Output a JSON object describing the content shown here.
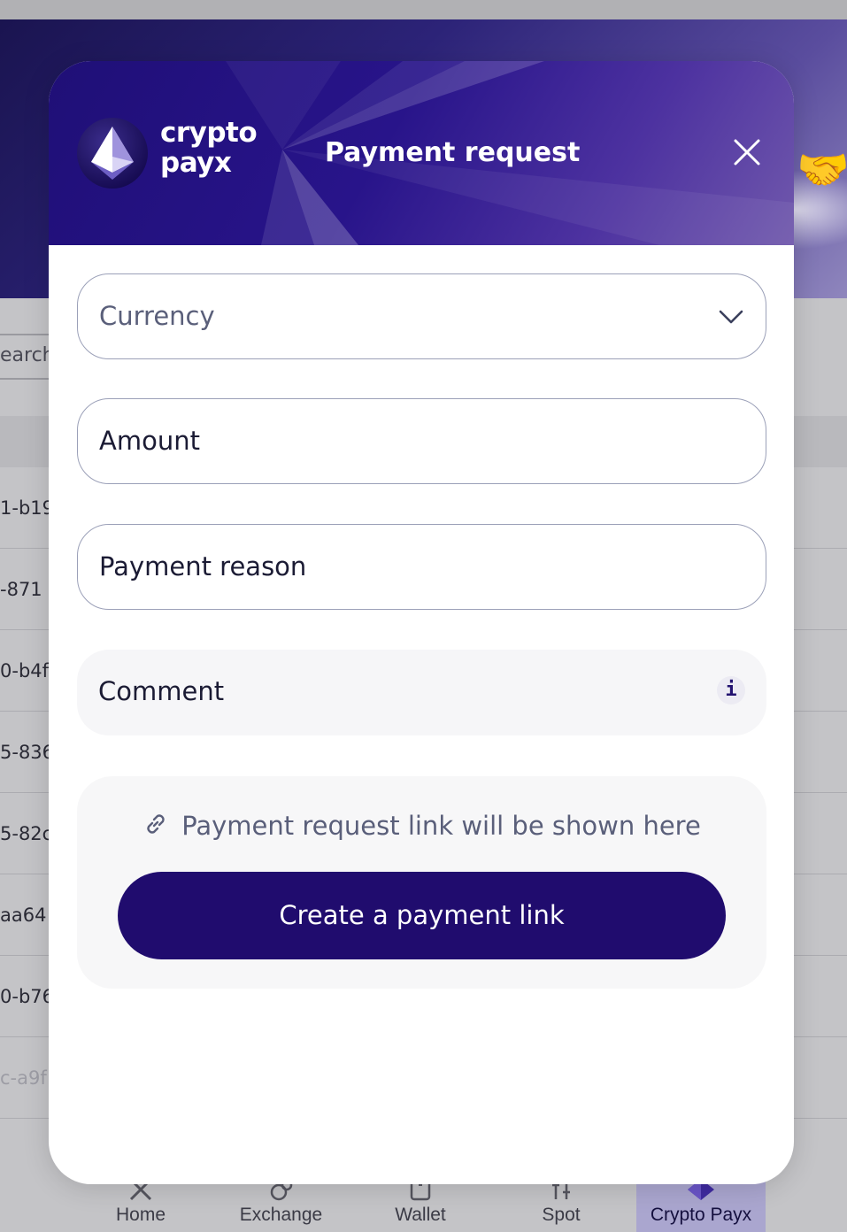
{
  "background_app": {
    "search": {
      "placeholder_fragment": "earch"
    },
    "rows": [
      "1-b19",
      "-871",
      "0-b4f",
      "5-836",
      "5-82c",
      "aa64",
      "0-b76",
      "c-a9f"
    ],
    "nav": {
      "items": [
        {
          "label": "Home",
          "icon": "x-logo-icon"
        },
        {
          "label": "Exchange",
          "icon": "exchange-icon"
        },
        {
          "label": "Wallet",
          "icon": "wallet-icon"
        },
        {
          "label": "Spot",
          "icon": "spot-icon"
        },
        {
          "label": "Crypto Payx",
          "icon": "crypto-payx-icon",
          "active": true
        }
      ]
    },
    "decoration_emoji": "🤝"
  },
  "modal": {
    "logo": {
      "line1": "crypto",
      "line2": "payx",
      "icon": "diamond-logo-icon"
    },
    "title": "Payment request",
    "close_icon": "close-icon",
    "fields": {
      "currency": {
        "placeholder": "Currency",
        "icon": "chevron-down-icon"
      },
      "amount": {
        "placeholder": "Amount"
      },
      "payment_reason": {
        "placeholder": "Payment reason"
      },
      "comment": {
        "placeholder": "Comment",
        "info_icon_text": "i"
      }
    },
    "link_panel": {
      "hint": "Payment request link will be shown here",
      "hint_icon": "link-icon",
      "button_label": "Create a payment link"
    }
  },
  "colors": {
    "header_primary": "#200c6e",
    "button_bg": "#200c6e",
    "muted_text": "#5a5f7a",
    "field_border": "#9ba0b8"
  }
}
